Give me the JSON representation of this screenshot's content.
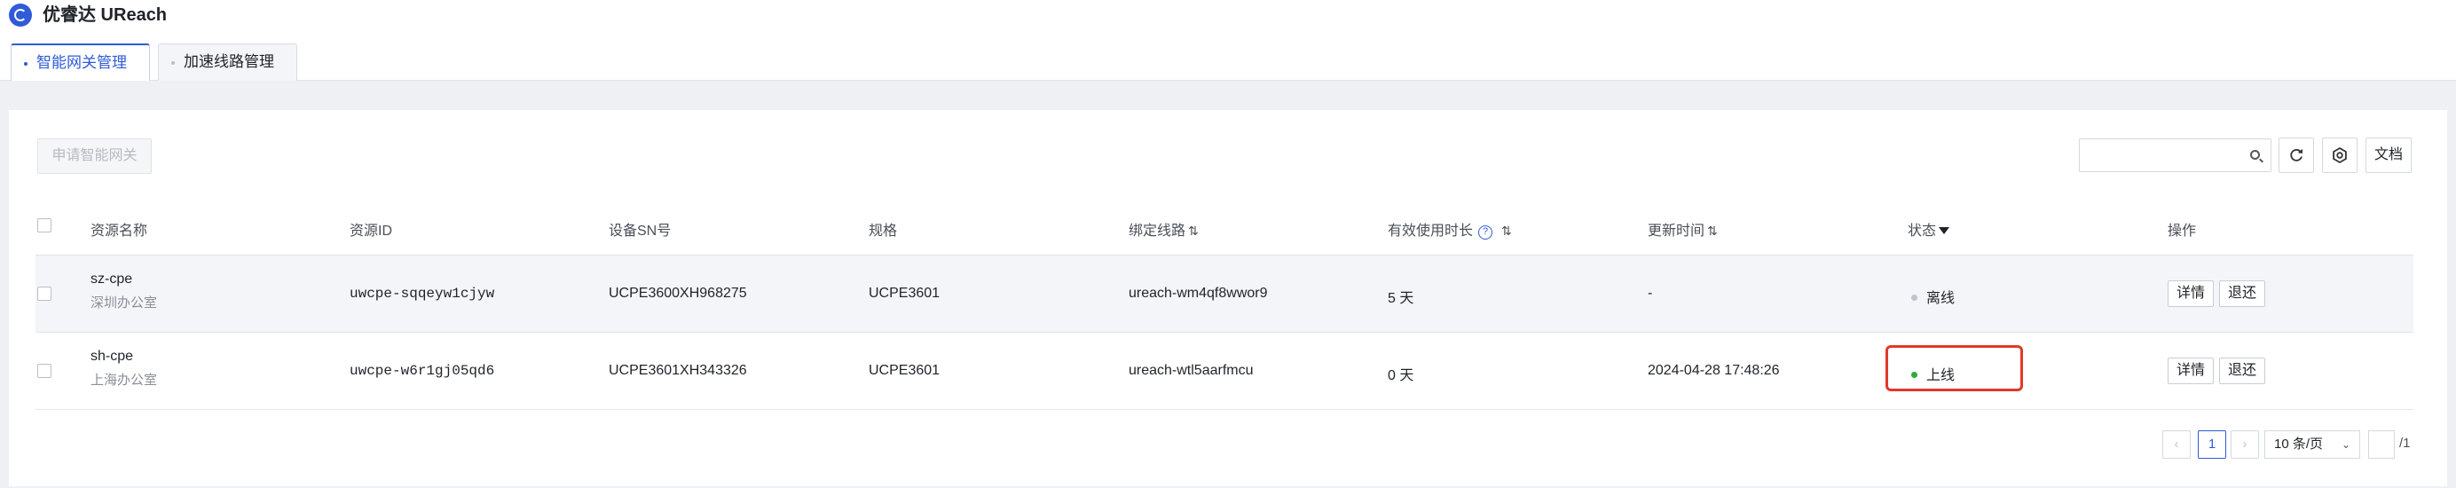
{
  "app": {
    "title": "优睿达 UReach"
  },
  "tabs": [
    {
      "label": "智能网关管理",
      "active": true
    },
    {
      "label": "加速线路管理",
      "active": false
    }
  ],
  "toolbar": {
    "apply_label": "申请智能网关",
    "search_placeholder": "",
    "refresh_icon": "refresh-icon",
    "settings_icon": "settings-gear-icon",
    "docs_label": "文档"
  },
  "table": {
    "columns": [
      "资源名称",
      "资源ID",
      "设备SN号",
      "规格",
      "绑定线路",
      "有效使用时长",
      "更新时间",
      "状态",
      "操作"
    ],
    "rows": [
      {
        "name": "sz-cpe",
        "location": "深圳办公室",
        "id": "uwcpe-sqqeyw1cjyw",
        "sn": "UCPE3600XH968275",
        "spec": "UCPE3601",
        "line": "ureach-wm4qf8wwor9",
        "duration": "5 天",
        "updated": "-",
        "status": "离线",
        "status_color": "#c0c4cc",
        "actions": [
          "详情",
          "退还"
        ]
      },
      {
        "name": "sh-cpe",
        "location": "上海办公室",
        "id": "uwcpe-w6r1gj05qd6",
        "sn": "UCPE3601XH343326",
        "spec": "UCPE3601",
        "line": "ureach-wtl5aarfmcu",
        "duration": "0 天",
        "updated": "2024-04-28 17:48:26",
        "status": "上线",
        "status_color": "#2dab3b",
        "actions": [
          "详情",
          "退还"
        ]
      }
    ]
  },
  "pagination": {
    "prev": "‹",
    "current_page": "1",
    "next": "›",
    "page_size": "10 条/页",
    "total_pages": "/1"
  },
  "colors": {
    "accent": "#2f5bd8",
    "highlight": "#e0392b",
    "online": "#2dab3b",
    "offline": "#c0c4cc"
  }
}
